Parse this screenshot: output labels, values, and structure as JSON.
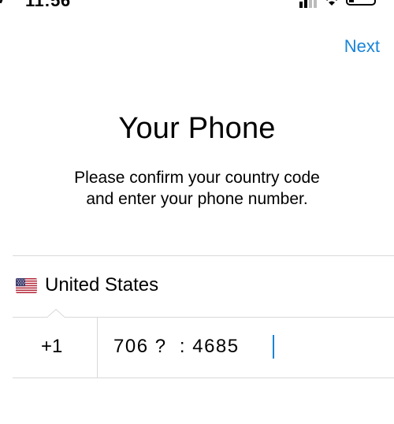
{
  "status_bar": {
    "time": "11:56"
  },
  "header": {
    "next_label": "Next"
  },
  "main": {
    "title": "Your Phone",
    "subtitle_line1": "Please confirm your country code",
    "subtitle_line2": "and enter your phone number."
  },
  "country": {
    "name": "United States",
    "flag_icon": "us-flag-icon"
  },
  "phone": {
    "country_code": "+1",
    "number": "706 ?  : 4685"
  },
  "colors": {
    "accent": "#1a84d8",
    "divider": "#d9d9d9"
  }
}
